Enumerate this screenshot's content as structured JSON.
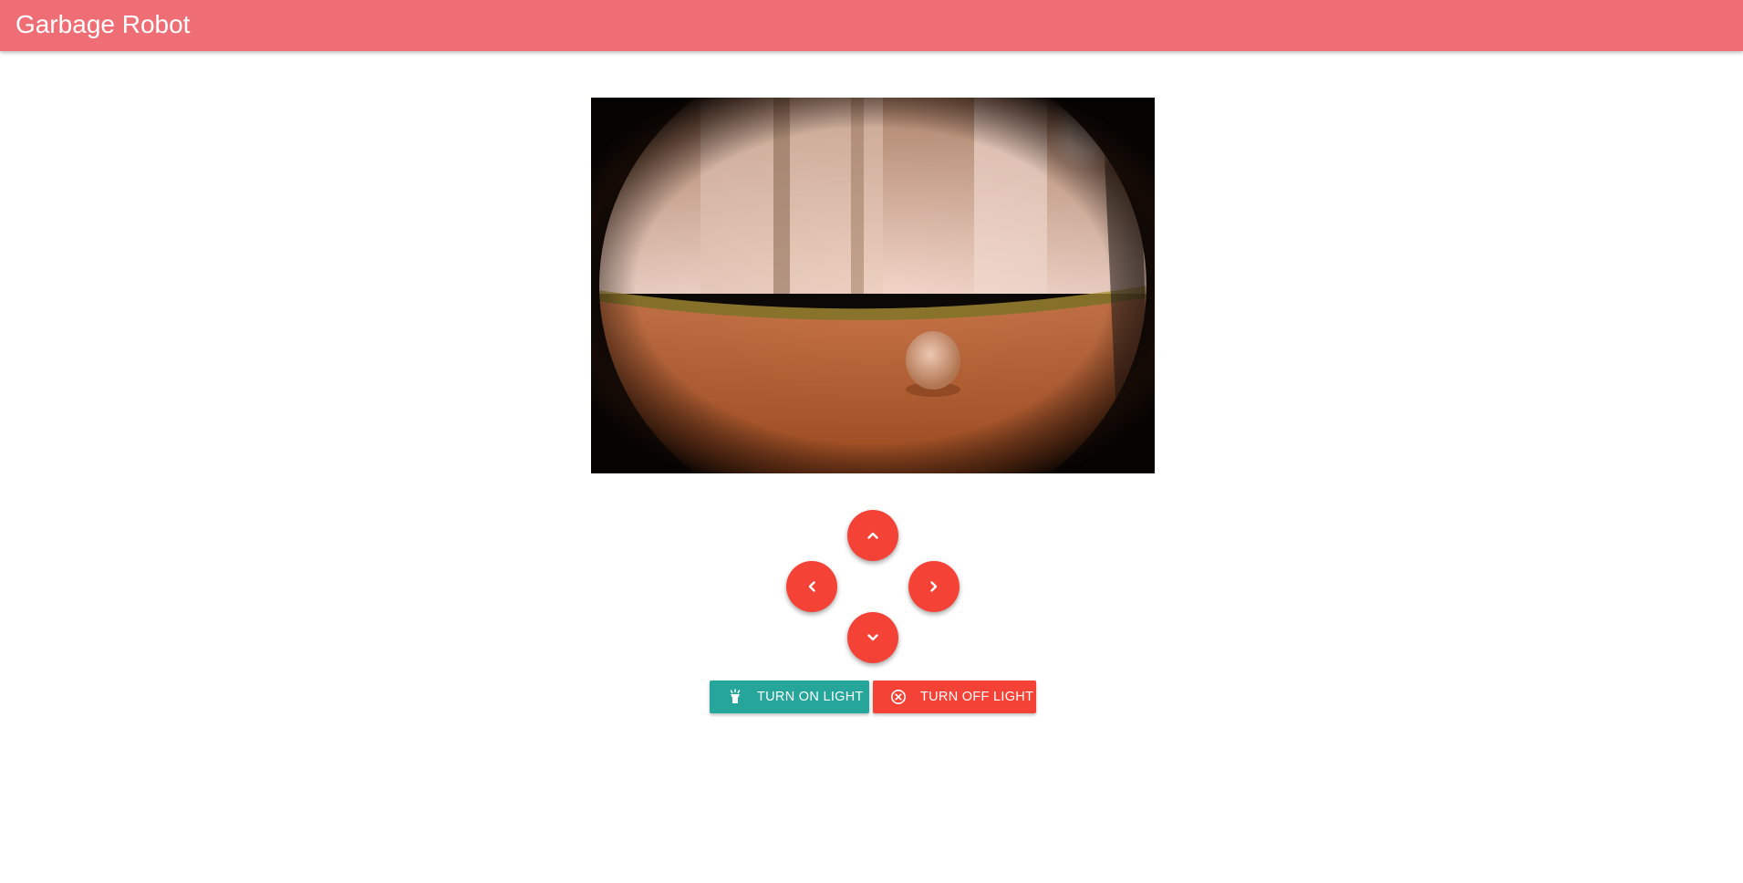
{
  "app_bar": {
    "title": "Garbage Robot",
    "color": "#ef6e75"
  },
  "camera": {
    "alt": "robot camera feed"
  },
  "controls": {
    "up_icon": "chevron-up-icon",
    "left_icon": "chevron-left-icon",
    "right_icon": "chevron-right-icon",
    "down_icon": "chevron-down-icon",
    "color": "#f44336"
  },
  "light": {
    "on_label": "TURN ON LIGHT",
    "on_icon": "flashlight-icon",
    "on_color": "#26a69a",
    "off_label": "TURN OFF LIGHT",
    "off_icon": "cancel-circle-icon",
    "off_color": "#f44336"
  }
}
